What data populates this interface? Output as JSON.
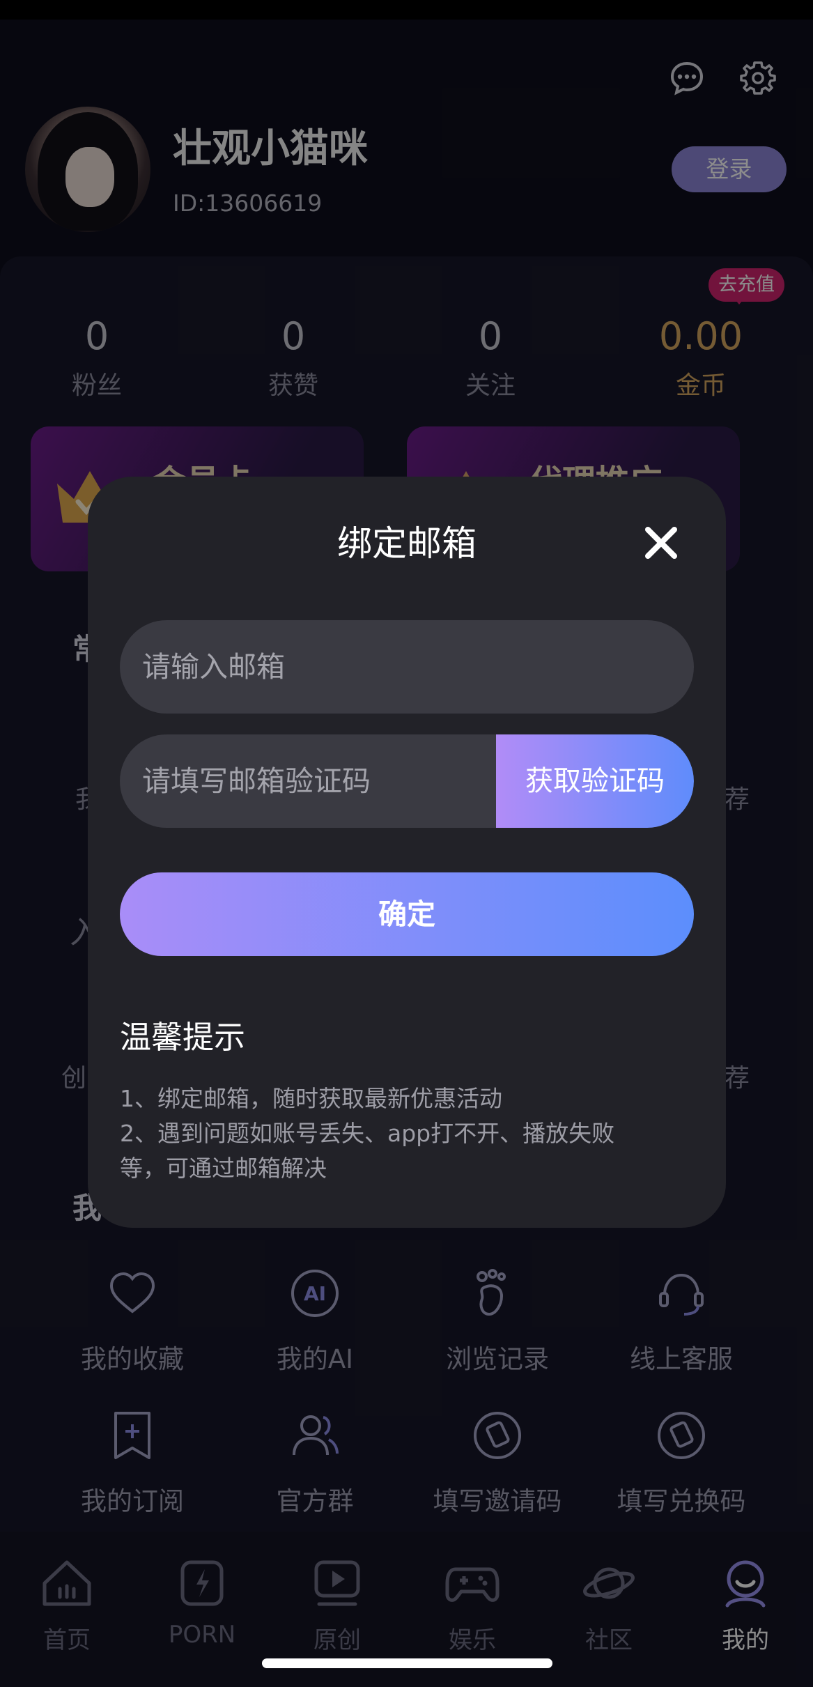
{
  "header": {
    "icons": [
      "chat-bubble-icon",
      "gear-icon"
    ],
    "username": "壮观小猫咪",
    "user_id": "ID:13606619",
    "login_label": "登录"
  },
  "stats": [
    {
      "value": "0",
      "label": "粉丝"
    },
    {
      "value": "0",
      "label": "获赞"
    },
    {
      "value": "0",
      "label": "关注"
    },
    {
      "value": "0.00",
      "label": "金币"
    }
  ],
  "recharge_badge": "去充值",
  "promos": [
    {
      "title": "会员卡",
      "icon": "crown-icon"
    },
    {
      "title": "代理推广",
      "icon": "crown-icon"
    }
  ],
  "background_fragments": {
    "a": "常",
    "b": "我",
    "c": "荐",
    "d": "入",
    "e": "创",
    "f": "荐",
    "g": "我"
  },
  "my_grid": [
    {
      "label": "我的收藏",
      "icon": "heart-icon"
    },
    {
      "label": "我的AI",
      "icon": "ai-icon"
    },
    {
      "label": "浏览记录",
      "icon": "footprint-icon"
    },
    {
      "label": "线上客服",
      "icon": "headset-icon"
    },
    {
      "label": "我的订阅",
      "icon": "bookmark-icon"
    },
    {
      "label": "官方群",
      "icon": "group-icon"
    },
    {
      "label": "填写邀请码",
      "icon": "ticket-icon"
    },
    {
      "label": "填写兑换码",
      "icon": "ticket-icon"
    }
  ],
  "bottom_nav": [
    {
      "label": "首页",
      "icon": "home-icon",
      "active": false
    },
    {
      "label": "PORN",
      "icon": "lightning-icon",
      "active": false
    },
    {
      "label": "原创",
      "icon": "play-icon",
      "active": false
    },
    {
      "label": "娱乐",
      "icon": "gamepad-icon",
      "active": false
    },
    {
      "label": "社区",
      "icon": "planet-icon",
      "active": false
    },
    {
      "label": "我的",
      "icon": "profile-icon",
      "active": true
    }
  ],
  "modal": {
    "title": "绑定邮箱",
    "email_placeholder": "请输入邮箱",
    "code_placeholder": "请填写邮箱验证码",
    "get_code_label": "获取验证码",
    "confirm_label": "确定",
    "tips_title": "温馨提示",
    "tips": [
      "1、绑定邮箱，随时获取最新优惠活动",
      "2、遇到问题如账号丢失、app打不开、播放失败",
      "等，可通过邮箱解决"
    ]
  },
  "colors": {
    "gradient_start": "#b18cf7",
    "gradient_end": "#5f8cfb",
    "gold": "#d6a660",
    "badge": "#d0246e",
    "modal_bg": "#222228"
  }
}
